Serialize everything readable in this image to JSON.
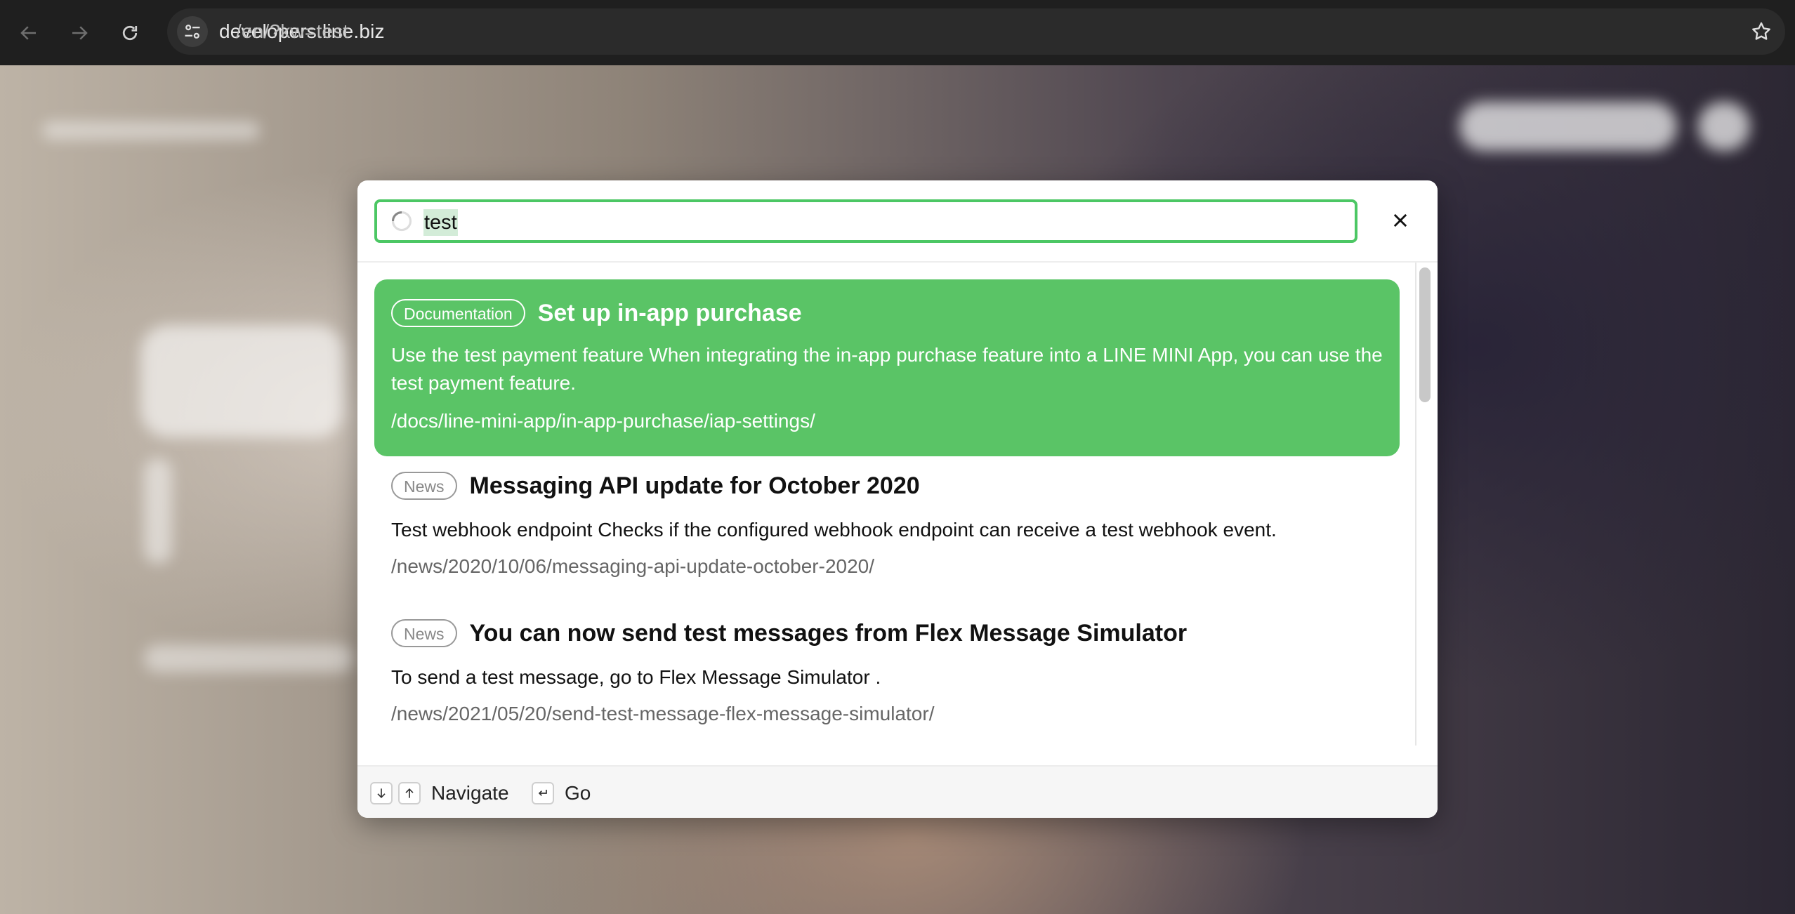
{
  "browser": {
    "url_host": "developers.line.biz",
    "url_path": "/en/?kw=test"
  },
  "search": {
    "value": "test"
  },
  "results": [
    {
      "badge": "Documentation",
      "title": "Set up in-app purchase",
      "description": "Use the test payment feature When integrating the in-app purchase feature into a LINE MINI App, you can use the test payment feature.",
      "path": "/docs/line-mini-app/in-app-purchase/iap-settings/",
      "active": true
    },
    {
      "badge": "News",
      "title": "Messaging API update for October 2020",
      "description": "Test webhook endpoint Checks if the configured webhook endpoint can receive a test webhook event.",
      "path": "/news/2020/10/06/messaging-api-update-october-2020/",
      "active": false
    },
    {
      "badge": "News",
      "title": "You can now send test messages from Flex Message Simulator",
      "description": "To send a test message, go to Flex Message Simulator .",
      "path": "/news/2021/05/20/send-test-message-flex-message-simulator/",
      "active": false
    }
  ],
  "footer": {
    "navigate_label": "Navigate",
    "go_label": "Go"
  },
  "colors": {
    "accent": "#4cc764",
    "active_result": "#5ac466"
  },
  "icons": {
    "back": "arrow-left-icon",
    "forward": "arrow-right-icon",
    "reload": "reload-icon",
    "site_info": "tune-icon",
    "bookmark": "star-icon",
    "loading": "spinner-icon",
    "close": "close-icon",
    "down_key": "arrow-down-icon",
    "up_key": "arrow-up-icon",
    "enter_key": "enter-icon"
  }
}
